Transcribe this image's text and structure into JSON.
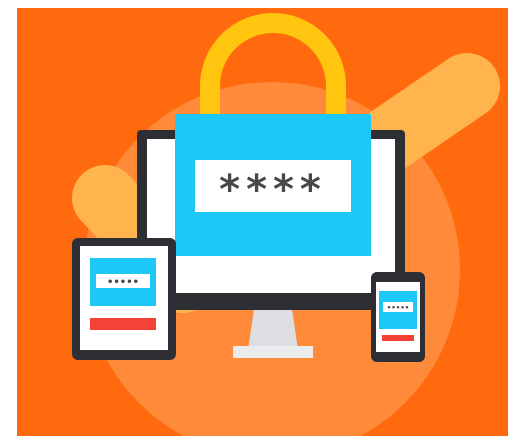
{
  "illustration": {
    "colors": {
      "background": "#FF6A0E",
      "circle": "#FF8A3A",
      "checkmark": "#FFB44D",
      "padlock_shackle": "#FFC50F",
      "lock_body": "#1EC8F6",
      "device_frame": "#2E2F35",
      "screen": "#FFFFFF",
      "monitor_stand": "#DCDEE1",
      "error_bar": "#F44336"
    },
    "monitor": {
      "password_mask": "****"
    },
    "tablet": {
      "password_mask": "•••••"
    },
    "phone": {
      "password_mask": "•••••"
    }
  }
}
